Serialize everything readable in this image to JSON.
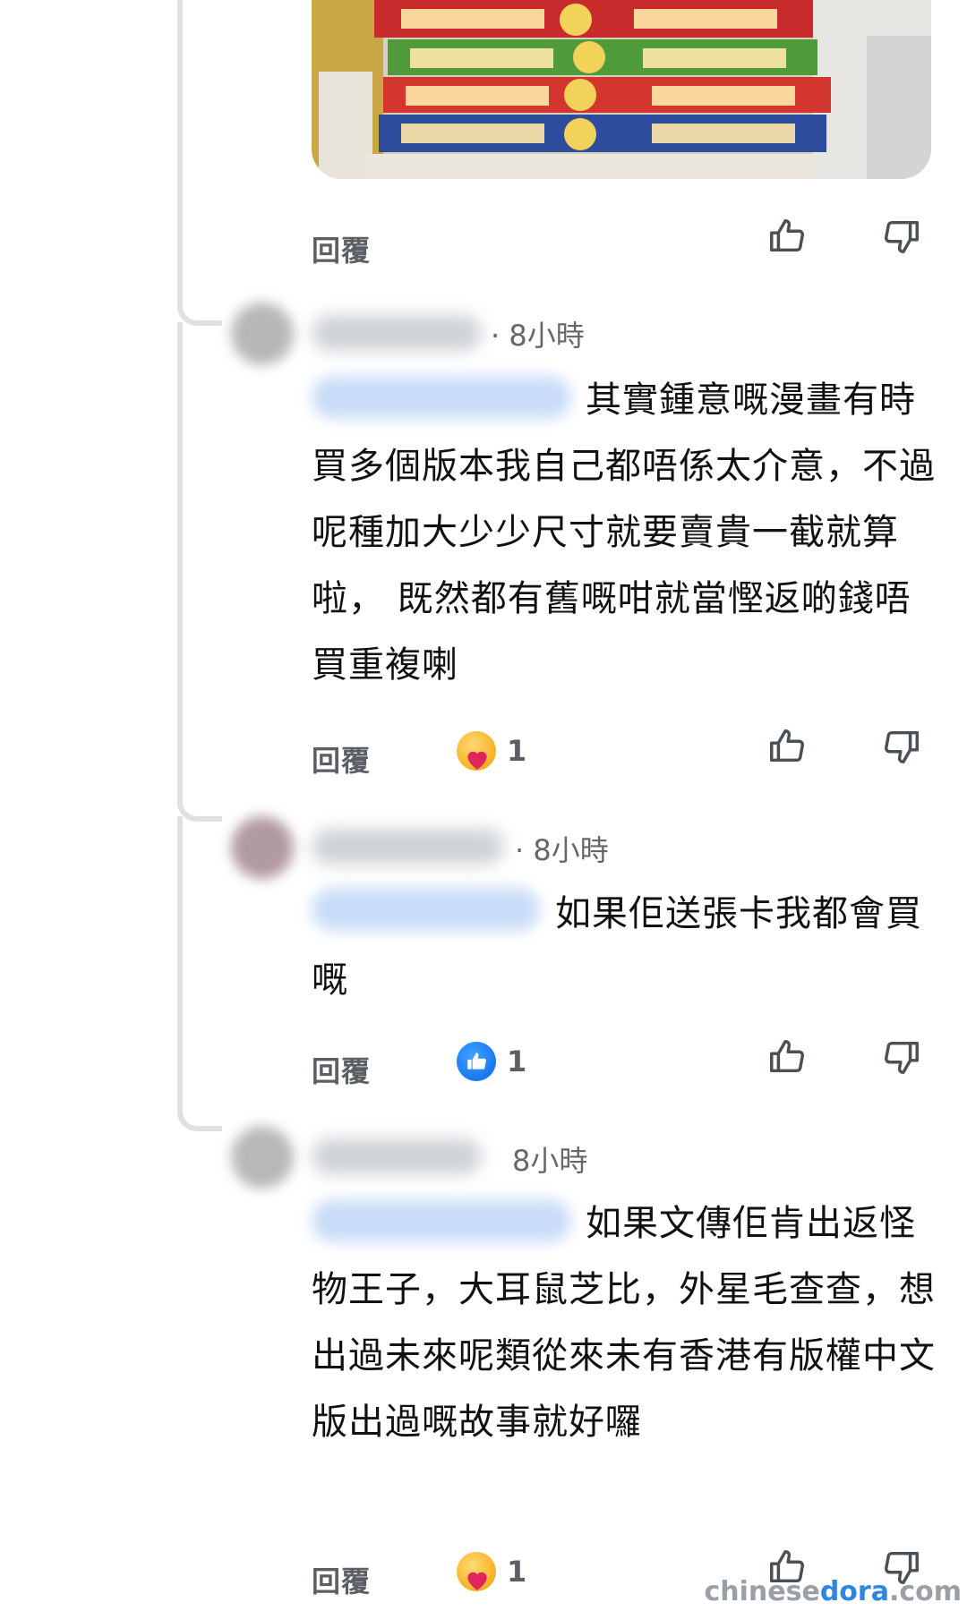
{
  "colors": {
    "thread_line": "#dde0e4",
    "secondary_text": "#65676b",
    "action_text": "#5b5e63",
    "like_blue": "#1877f2",
    "mention_highlight": "#c9dcf7"
  },
  "top_post": {
    "image_icon": "manga-books-photo",
    "actions": {
      "reply_label": "回覆"
    }
  },
  "comments": [
    {
      "timestamp": "· 8小時",
      "text": "其實鍾意嘅漫畫有時買多個版本我自己都唔係太介意，不過呢種加大少少尺寸就要賣貴一截就算啦， 既然都有舊嘅咁就當慳返啲錢唔買重複喇",
      "reply_label": "回覆",
      "reaction_icon": "care-emoji",
      "reaction_count": "1"
    },
    {
      "timestamp": "· 8小時",
      "text": "如果佢送張卡我都會買嘅",
      "reply_label": "回覆",
      "reaction_icon": "like-emoji",
      "reaction_count": "1"
    },
    {
      "timestamp": "8小時",
      "text": "如果文傳佢肯出返怪物王子，大耳鼠芝比，外星毛查查，想出過未來呢類從來未有香港有版權中文版出過嘅故事就好囉",
      "reply_label": "回覆",
      "reaction_icon": "care-emoji",
      "reaction_count": "1"
    }
  ],
  "watermark": {
    "part1": "chinese",
    "part2": "dora",
    "part3": ".com"
  }
}
